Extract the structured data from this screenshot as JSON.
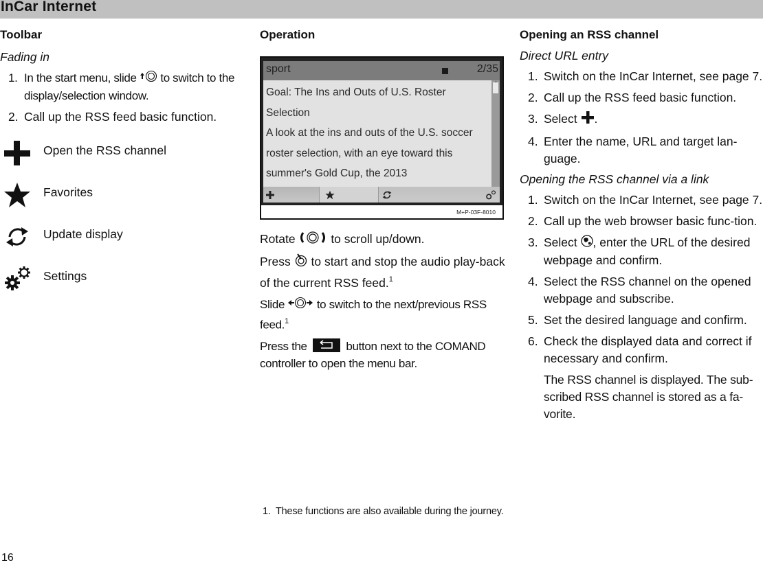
{
  "header": {
    "title": "InCar Internet"
  },
  "left": {
    "heading": "Toolbar",
    "subheading": "Fading in",
    "steps": [
      {
        "num": "1.",
        "text_before": "In the start menu, slide",
        "icon": "controller-slide-up-icon",
        "text_after": "to switch to the display/selection window."
      },
      {
        "num": "2.",
        "text": "Call up the RSS feed basic function."
      }
    ],
    "toolbar_items": [
      {
        "icon": "plus-icon",
        "label": "Open the RSS channel"
      },
      {
        "icon": "star-icon",
        "label": "Favorites"
      },
      {
        "icon": "refresh-icon",
        "label": "Update display"
      },
      {
        "icon": "settings-gears-icon",
        "label": "Settings"
      }
    ]
  },
  "middle": {
    "heading": "Operation",
    "figure": {
      "channel": "sport",
      "counter": "2/35",
      "lines": [
        "Goal: The Ins and Outs of U.S. Roster",
        "Selection",
        "A look at the ins and outs of the U.S. soccer",
        "roster selection, with an eye toward this",
        "summer's Gold Cup, the 2013"
      ],
      "code": "M+P-03F-8010"
    },
    "paragraphs": [
      {
        "before": "Rotate",
        "icon": "controller-rotate-icon",
        "after": "to scroll up/down.",
        "sup": ""
      },
      {
        "before": "Press",
        "icon": "controller-press-icon",
        "after": "to start and stop the audio play-back of the current RSS feed.",
        "sup": "1"
      },
      {
        "before": "Slide",
        "icon": "controller-slide-left-right-icon",
        "after": " to switch to the next/previous RSS feed.",
        "sup": "1"
      },
      {
        "before": "Press the",
        "icon": "back-button-icon",
        "after": "button next to the COMAND controller to open the menu bar.",
        "sup": ""
      }
    ],
    "footnote": {
      "num": "1.",
      "text": "These functions are also available during the journey."
    }
  },
  "right": {
    "heading": "Opening an RSS channel",
    "section1": {
      "subheading": "Direct URL entry",
      "steps": [
        {
          "num": "1.",
          "text": "Switch on the InCar Internet, see page 7."
        },
        {
          "num": "2.",
          "text": "Call up the RSS feed basic function."
        },
        {
          "num": "3.",
          "text_before": "Select",
          "icon": "plus-icon",
          "text_after": "."
        },
        {
          "num": "4.",
          "text": "Enter the name, URL and target lan-guage."
        }
      ]
    },
    "section2": {
      "subheading": "Opening the RSS channel via a link",
      "steps": [
        {
          "num": "1.",
          "text": "Switch on the InCar Internet, see page 7."
        },
        {
          "num": "2.",
          "text": "Call up the web browser basic func-tion."
        },
        {
          "num": "3.",
          "text_before": "Select",
          "icon": "globe-icon",
          "text_after": ", enter the URL of the desired webpage and confirm."
        },
        {
          "num": "4.",
          "text": "Select the RSS channel on the opened webpage and subscribe."
        },
        {
          "num": "5.",
          "text": "Set the desired language and confirm."
        },
        {
          "num": "6.",
          "text": "Check the displayed data and correct if necessary and confirm."
        }
      ],
      "result": "The RSS channel is displayed. The sub-scribed RSS channel is stored as a fa-vorite."
    }
  },
  "page_number": "16"
}
